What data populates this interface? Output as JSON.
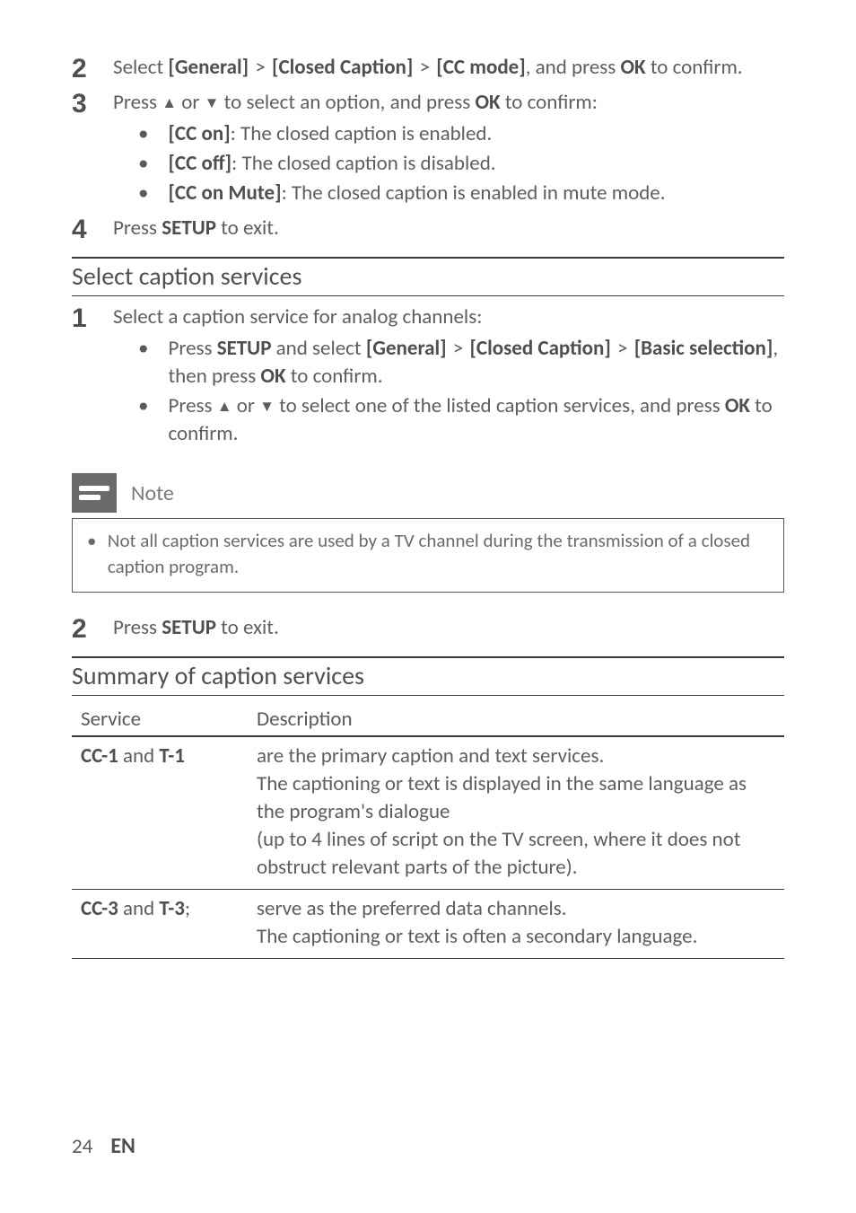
{
  "step2": {
    "num": "2",
    "pre": "Select ",
    "path1": "[General]",
    "gt": " > ",
    "path2": "[Closed Caption]",
    "path3": "[CC mode]",
    "mid": ", and press ",
    "ok": "OK",
    "post": " to confirm."
  },
  "step3": {
    "num": "3",
    "pre": "Press ",
    "up": "▲",
    "or": " or ",
    "down": "▼",
    "mid": " to select an option, and press ",
    "ok": "OK",
    "post": " to confirm:",
    "opts": [
      {
        "label": "[CC on]",
        "desc": ": The closed caption is enabled."
      },
      {
        "label": "[CC off]",
        "desc": ": The closed caption is disabled."
      },
      {
        "label": "[CC on Mute]",
        "desc": ": The closed caption is enabled in mute mode."
      }
    ]
  },
  "step4": {
    "num": "4",
    "pre": "Press ",
    "setup": "SETUP",
    "post": " to exit."
  },
  "section1_heading": "Select caption services",
  "s1_step1": {
    "num": "1",
    "text": "Select a caption service for analog channels:",
    "b1": {
      "pre": "Press ",
      "setup": "SETUP",
      "mid": " and select ",
      "p1": "[General]",
      "gt": " > ",
      "p2": "[Closed Caption]",
      "p3": "[Basic selection]",
      "mid2": ", then press ",
      "ok": "OK",
      "post": " to confirm."
    },
    "b2": {
      "pre": "Press ",
      "up": "▲",
      "or": " or ",
      "down": "▼",
      "mid": " to select one of the listed caption services, and press ",
      "ok": "OK",
      "post": " to confirm."
    }
  },
  "note": {
    "label": "Note",
    "text": "Not all caption services are used by a TV channel during the transmission of a closed caption program."
  },
  "s1_step2": {
    "num": "2",
    "pre": "Press ",
    "setup": "SETUP",
    "post": " to exit."
  },
  "section2_heading": "Summary of caption services",
  "table": {
    "head_service": "Service",
    "head_desc": "Description",
    "rows": [
      {
        "svc_a": "CC-1",
        "svc_and": " and ",
        "svc_b": "T-1",
        "desc": "are the primary caption and text services.\nThe captioning or text is displayed in the same language as the program's dialogue\n(up to 4 lines of script on the TV screen, where it does not obstruct relevant parts of the picture)."
      },
      {
        "svc_a": "CC-3",
        "svc_and": " and ",
        "svc_b": "T-3",
        "svc_suffix": ";",
        "desc": "serve as the preferred data channels.\nThe captioning or text is often a secondary language."
      }
    ]
  },
  "footer": {
    "page": "24",
    "lang": "EN"
  }
}
